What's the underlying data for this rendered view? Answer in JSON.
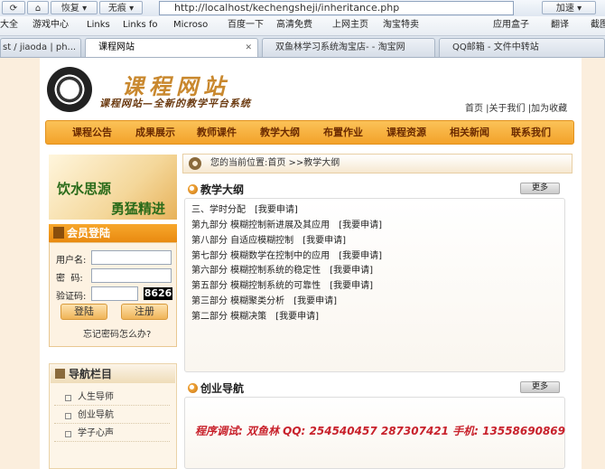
{
  "browser": {
    "nav_buttons": [
      "恢复",
      "无痕"
    ],
    "url": "http://localhost/kechengsheji/inheritance.php",
    "right_buttons": [
      "加速"
    ],
    "bookmarks": [
      "大全",
      "游戏中心",
      "Links",
      "Links fo",
      "Microso",
      "百度一下",
      "高清免费",
      "上网主页",
      "淘宝特卖",
      "应用盒子",
      "翻译",
      "截图"
    ],
    "tabs": [
      {
        "title": "st / jiaoda | ph...",
        "active": false
      },
      {
        "title": "课程网站",
        "active": true
      },
      {
        "title": "双鱼林学习系统淘宝店- - 淘宝网",
        "active": false
      },
      {
        "title": "QQ邮箱 - 文件中转站",
        "active": false
      }
    ]
  },
  "site": {
    "title": "课程网站",
    "slogan": "课程网站—全新的教学平台系统",
    "top_links": "首页 |关于我们 |加为收藏",
    "menu": [
      "课程公告",
      "成果展示",
      "教师课件",
      "教学大纲",
      "布置作业",
      "课程资源",
      "相关新闻",
      "联系我们"
    ]
  },
  "banner": {
    "line1": "饮水思源",
    "line2": "勇猛精进"
  },
  "login": {
    "heading": "会员登陆",
    "username_label": "用户名:",
    "password_label": "密  码:",
    "captcha_label": "验证码:",
    "captcha_value": "8626",
    "login_button": "登陆",
    "register_button": "注册",
    "forgot": "忘记密码怎么办?"
  },
  "nav": {
    "heading": "导航栏目",
    "items": [
      "人生导师",
      "创业导航",
      "学子心声"
    ]
  },
  "breadcrumb": "您的当前位置:首页 >>教学大纲",
  "syllabus": {
    "title": "教学大纲",
    "more": "更多",
    "apply": "[我要申请]",
    "items": [
      "三、学时分配",
      "第九部分  模糊控制新进展及其应用",
      "第八部分  自适应模糊控制",
      "第七部分  模糊数学在控制中的应用",
      "第六部分  模糊控制系统的稳定性",
      "第五部分  模糊控制系统的可靠性",
      "第三部分  模糊聚类分析",
      "第二部分  模糊决策"
    ]
  },
  "startup": {
    "title": "创业导航",
    "more": "更多",
    "contact": "程序调试: 双鱼林  QQ: 254540457  287307421    手机: 13558690869"
  }
}
